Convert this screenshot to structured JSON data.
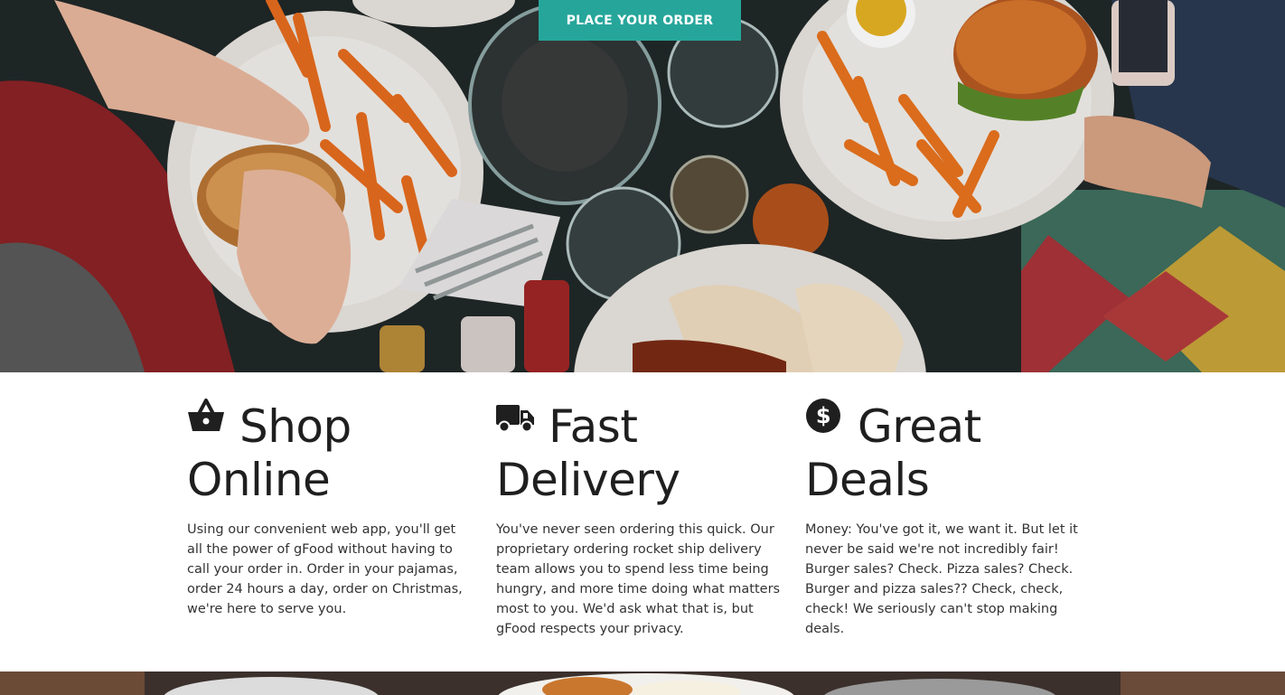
{
  "hero": {
    "cta_label": "PLACE YOUR ORDER",
    "image_alt": "Overhead view of a table with burgers, fries, glasses and bread"
  },
  "features": [
    {
      "icon": "shopping-basket-icon",
      "title_line1": "Shop",
      "title_line2": "Online",
      "body": "Using our convenient web app, you'll get all the power of gFood without having to call your order in. Order in your pajamas, order 24 hours a day, order on Christmas, we're here to serve you."
    },
    {
      "icon": "delivery-truck-icon",
      "title_line1": "Fast",
      "title_line2": "Delivery",
      "body": "You've never seen ordering this quick. Our proprietary ordering rocket ship delivery team allows you to spend less time being hungry, and more time doing what matters most to you. We'd ask what that is, but gFood respects your privacy."
    },
    {
      "icon": "dollar-circle-icon",
      "title_line1": "Great",
      "title_line2": "Deals",
      "body": "Money: You've got it, we want it. But let it never be said we're not incredibly fair! Burger sales? Check. Pizza sales? Check. Burger and pizza sales?? Check, check, check! We seriously can't stop making deals."
    }
  ],
  "colors": {
    "accent": "#26a69a",
    "heading": "#1f1f1f",
    "body_text": "#333333"
  }
}
